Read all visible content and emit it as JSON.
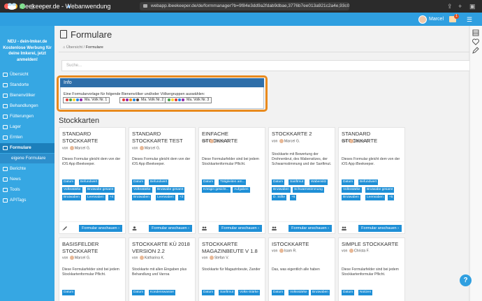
{
  "browser": {
    "url": "webapp.ibeekeeper.de/de/formmanager?b=9f84e3dd9a2fdab9dbae,3776b7ee013a921c2a4e,93c06579..."
  },
  "app": {
    "brand": "iBeekeeper.de - Webanwendung",
    "user_name": "Marcel",
    "notification_count": "1"
  },
  "sidebar": {
    "promo": "NEU - dein-Imker.de Kostenlose Werbung für deine Imkerei, jetzt anmelden!",
    "items": [
      {
        "label": "Übersicht",
        "icon": "dashboard-icon"
      },
      {
        "label": "Standorte",
        "icon": "pin-icon"
      },
      {
        "label": "Bienenvölker",
        "icon": "hive-icon"
      },
      {
        "label": "Behandlungen",
        "icon": "treatment-icon"
      },
      {
        "label": "Fütterungen",
        "icon": "feeding-icon"
      },
      {
        "label": "Lager",
        "icon": "storage-icon"
      },
      {
        "label": "Ernten",
        "icon": "harvest-icon"
      },
      {
        "label": "Formulare",
        "icon": "form-icon"
      },
      {
        "label": "eigene Formulare",
        "icon": ""
      },
      {
        "label": "Berichte",
        "icon": "report-icon"
      },
      {
        "label": "News",
        "icon": "news-icon"
      },
      {
        "label": "Tools",
        "icon": "tools-icon"
      },
      {
        "label": "APITags",
        "icon": "tag-icon"
      }
    ]
  },
  "main": {
    "title": "Formulare",
    "breadcrumb": {
      "home": "Übersicht",
      "separator": "/",
      "current": "Formulare"
    },
    "search_placeholder": "Suche...",
    "info": {
      "header": "Info",
      "text": "Eine Formularvorlage für folgende Bienenvölker und/oder Völkergruppen auswählen:",
      "colonies": [
        "Ma. Volk Nr. 1",
        "Ma. Volk Nr. 2",
        "Ma. Volk Nr. 3"
      ]
    },
    "section_title": "Stockkarten",
    "button_label": "Formular anschauen",
    "cards": [
      {
        "title": "STANDARD STOCKKARTE",
        "author": "Marcel G.",
        "desc": "Dieses Formular gleicht dem von der iOS App iBeekeeper.",
        "tags": [
          "Datum",
          "Befundwert",
          "Volksstärke",
          "Brutwabe gesamt",
          "Brutwaben",
          "Leerwaben",
          "+4"
        ]
      },
      {
        "title": "STANDARD STOCKKARTE TEST",
        "author": "Marcel G.",
        "desc": "Dieses Formular gleicht dem von der iOS App iBeekeeper.",
        "tags": [
          "Datum",
          "Befundwert",
          "Volksstärke",
          "Brutwabe gesamt",
          "Brutwaben",
          "Leerwaben",
          "+3"
        ]
      },
      {
        "title": "EINFACHE STOCKKARTE",
        "author": "Marcel G.",
        "desc": "Diese Formularfelder sind bei jedem Stockkartenformular Pflicht.",
        "tags": [
          "Datum",
          "Tätigkeiten am...",
          "Königin gesicht...",
          "Aufgaben"
        ]
      },
      {
        "title": "STOCKKARTE 2",
        "author": "Marcel G.",
        "desc": "Stockkarte mit Bewertung der Drohnenbrut, des Wabensitzes, der Schwarmstimmung und der Sanftmut.",
        "tags": [
          "Datum",
          "Sanftmut",
          "Wabensitz",
          "Brutwaben",
          "Schwarmstimmung",
          "D. Stifte",
          "+6"
        ]
      },
      {
        "title": "STANDARD STOCKKARTE",
        "author": "Marcel G.",
        "desc": "Dieses Formular gleicht dem von der iOS App iBeekeeper.",
        "tags": [
          "Datum",
          "Befundwert",
          "Volksstärke",
          "Brutwabe gesamt",
          "Brutwaben",
          "Leerwaben",
          "+5"
        ]
      },
      {
        "title": "BASISFELDER STOCKKARTE",
        "author": "Marcel G.",
        "desc": "Diese Formularfelder sind bei jedem Stockkartenformular Pflicht.",
        "tags": [
          "Datum"
        ]
      },
      {
        "title": "STOCKKARTE KÜ 2018 VERSION 2.2",
        "author": "Katharina K.",
        "desc": "Stockkarte mit allen Eingaben plus Behandlung und Varroa",
        "tags": [
          "Datum",
          "Kondenswasser"
        ]
      },
      {
        "title": "STOCKKARTE MAGAZINBEUTE V 1.8",
        "author": "Stefan V.",
        "desc": "Stockkarte für Magazinbeute, Zander",
        "tags": [
          "Datum",
          "Sanftmut",
          "Volks-Stärke"
        ]
      },
      {
        "title": "ISTOCKKARTE",
        "author": "Isam R.",
        "desc": "Das, was eigentlich alle haben",
        "tags": [
          "Datum",
          "Volksstärke",
          "Brutwaben"
        ]
      },
      {
        "title": "SIMPLE STOCKKARTE",
        "author": "Christa F.",
        "desc": "Diese Formularfelder sind bei jedem Stockkartenformular Pflicht.",
        "tags": [
          "Datum",
          "Notizen"
        ]
      }
    ]
  },
  "help_label": "?"
}
